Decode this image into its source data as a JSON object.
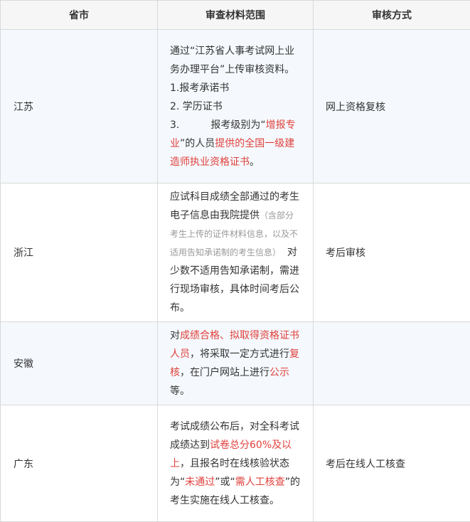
{
  "header": {
    "province": "省市",
    "materials": "审查材料范围",
    "method": "审核方式"
  },
  "rows": [
    {
      "province": "江苏",
      "method": "网上资格复核",
      "m_intro": "通过“江苏省人事考试网上业务办理平台”上传审核资料。",
      "m_item1": "1.报考承诺书",
      "m_item2": "2. 学历证书",
      "m_item3_num": "3.",
      "m_item3_a": "报考级别为“",
      "m_item3_red1": "增报专业",
      "m_item3_b": "”的人员",
      "m_item3_red2": "提供的全国一级建造师执业资格证书",
      "m_item3_c": "。"
    },
    {
      "province": "浙江",
      "method": "考后审核",
      "m_a": "应试科目成绩全部通过的考生电子信息由我院提供",
      "m_gray": "（含部分考生上传的证件材料信息，以及不适用告知承诺制的考生信息）",
      "m_b": "  对少数不适用告知承诺制，需进行现场审核，具体时间考后公布。"
    },
    {
      "province": "安徽",
      "method": "",
      "m_a": "对",
      "m_red1": "成绩合格、拟取得资格证书人员",
      "m_b": "，将采取一定方式进行",
      "m_red2": "复核",
      "m_c": "，在门户网站上进行",
      "m_red3": "公示",
      "m_d": "等。"
    },
    {
      "province": "广东",
      "method": "考后在线人工核查",
      "m_a": "考试成绩公布后，对全科考试成绩达到",
      "m_red1": "试卷总分60%及以上",
      "m_b": "，且报名时在线核验状态为“",
      "m_red2": "未通过",
      "m_c": "”或“",
      "m_red3": "需人工核查",
      "m_d": "”的考生实施在线人工核查。"
    }
  ]
}
